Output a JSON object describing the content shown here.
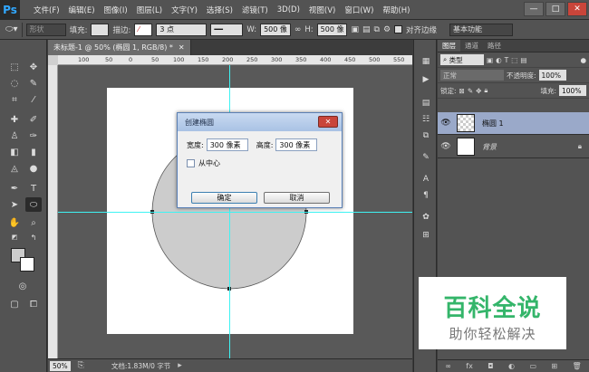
{
  "app": {
    "logo": "Ps"
  },
  "menu": [
    "文件(F)",
    "编辑(E)",
    "图像(I)",
    "图层(L)",
    "文字(Y)",
    "选择(S)",
    "滤镜(T)",
    "3D(D)",
    "视图(V)",
    "窗口(W)",
    "帮助(H)"
  ],
  "window_controls": {
    "minimize": "—",
    "restore": "□",
    "close": "✕"
  },
  "options": {
    "shape_mode": "形状",
    "fill_label": "填充:",
    "stroke_label": "描边:",
    "stroke_size": "3 点",
    "w_label": "W:",
    "w_value": "500 像",
    "h_label": "H:",
    "h_value": "500 像",
    "align_edges": "对齐边缘",
    "workspace": "基本功能"
  },
  "document": {
    "tab_title": "未标题-1 @ 50% (椭圆 1, RGB/8) *",
    "ruler_ticks": [
      "100",
      "50",
      "0",
      "50",
      "100",
      "150",
      "200",
      "250",
      "300",
      "350",
      "400",
      "450",
      "500",
      "550"
    ],
    "zoom": "50%",
    "doc_info": "文档:1.83M/0 字节"
  },
  "dialog": {
    "title": "创建椭圆",
    "width_label": "宽度:",
    "width_value": "300 像素",
    "height_label": "高度:",
    "height_value": "300 像素",
    "from_center": "从中心",
    "ok": "确定",
    "cancel": "取消"
  },
  "layers_panel": {
    "tabs": [
      "图层",
      "通道",
      "路径"
    ],
    "filter_kind": "类型",
    "blend_mode": "正常",
    "opacity_label": "不透明度:",
    "opacity_value": "100%",
    "lock_label": "锁定:",
    "fill_label": "填充:",
    "fill_value": "100%",
    "layers": [
      {
        "name": "椭圆 1"
      },
      {
        "name": "背景"
      }
    ]
  },
  "watermark": {
    "main": "百科全说",
    "sub": "助你轻松解决"
  },
  "colors": {
    "guide": "#3ef3f3",
    "ellipse_fill": "#cccccc",
    "selected_layer": "#9aa9c9",
    "watermark_green": "#34b56a"
  }
}
